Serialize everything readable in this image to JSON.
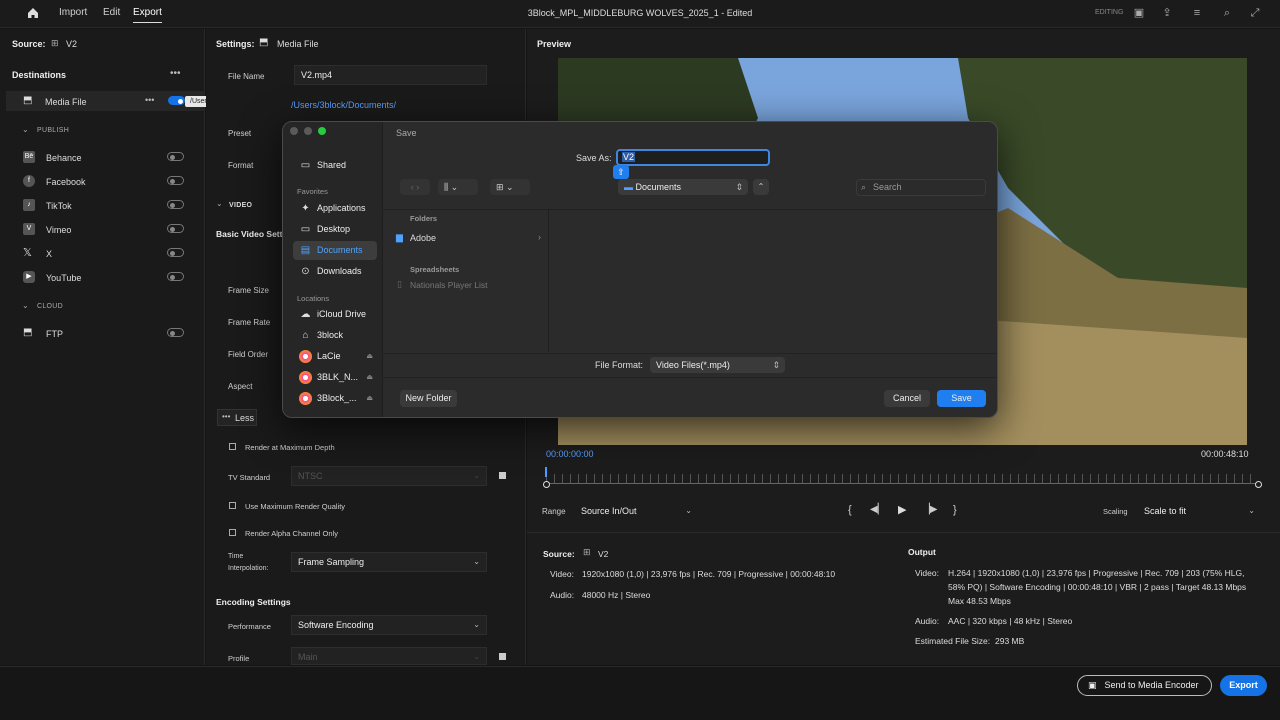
{
  "topbar": {
    "nav": [
      "Import",
      "Edit",
      "Export"
    ],
    "title": "3Block_MPL_MIDDLEBURG WOLVES_2025_1 - Edited",
    "mode": "EDITING"
  },
  "left": {
    "source_label": "Source:",
    "source_value": "V2",
    "destinations_title": "Destinations",
    "media_file": "Media File",
    "path_tooltip": "/Users/3block/Documents/",
    "publish_header": "PUBLISH",
    "publish_items": [
      "Behance",
      "Facebook",
      "TikTok",
      "Vimeo",
      "X",
      "YouTube"
    ],
    "cloud_header": "CLOUD",
    "cloud_items": [
      "FTP"
    ]
  },
  "settings": {
    "settings_label": "Settings:",
    "settings_value": "Media File",
    "file_name_label": "File Name",
    "file_name_value": "V2.mp4",
    "location_value": "/Users/3block/Documents/",
    "preset_label": "Preset",
    "format_label": "Format",
    "video_header": "VIDEO",
    "basic_video": "Basic Video Setti",
    "frame_size": "Frame Size",
    "frame_rate": "Frame Rate",
    "field_order": "Field Order",
    "aspect": "Aspect",
    "less_label": "Less",
    "render_max_depth": "Render at Maximum Depth",
    "tv_standard_label": "TV Standard",
    "tv_standard_value": "NTSC",
    "max_render_quality": "Use Maximum Render Quality",
    "alpha_only": "Render Alpha Channel Only",
    "time_interp_label_1": "Time",
    "time_interp_label_2": "Interpolation:",
    "time_interp_value": "Frame Sampling",
    "encoding_settings": "Encoding Settings",
    "performance_label": "Performance",
    "performance_value": "Software Encoding",
    "profile_label": "Profile",
    "profile_value": "Main"
  },
  "preview": {
    "title": "Preview",
    "time_start": "00:00:00:00",
    "time_end": "00:00:48:10",
    "range_label": "Range",
    "range_value": "Source In/Out",
    "scaling_label": "Scaling",
    "scaling_value": "Scale to fit"
  },
  "source_info": {
    "label": "Source:",
    "name": "V2",
    "video_label": "Video:",
    "video_value": "1920x1080 (1,0)  |  23,976 fps  |  Rec. 709  |  Progressive  |  00:00:48:10",
    "audio_label": "Audio:",
    "audio_value": "48000 Hz  |  Stereo"
  },
  "output_info": {
    "label": "Output",
    "video_label": "Video:",
    "video_line1": "H.264  |  1920x1080 (1,0)  |  23,976 fps  |  Progressive  |  Rec. 709  |  203 (75% HLG,",
    "video_line2": "58% PQ)  |  Software Encoding  |  00:00:48:10  |  VBR  |  2 pass  |  Target 48.13 Mbps",
    "video_line3": "Max 48.53 Mbps",
    "audio_label": "Audio:",
    "audio_value": "AAC  |  320 kbps  |  48 kHz  |  Stereo",
    "size_label": "Estimated File Size:",
    "size_value": "293 MB"
  },
  "footer": {
    "send_label": "Send to Media Encoder",
    "export_label": "Export"
  },
  "dialog": {
    "title": "Save",
    "save_as_label": "Save As:",
    "save_as_value": "V2",
    "location": "Documents",
    "search_placeholder": "Search",
    "sidebar_shared": "Shared",
    "favorites_header": "Favorites",
    "favorites": [
      "Applications",
      "Desktop",
      "Documents",
      "Downloads"
    ],
    "locations_header": "Locations",
    "locations": [
      "iCloud Drive",
      "3block",
      "LaCie",
      "3BLK_N...",
      "3Block_..."
    ],
    "folders_header": "Folders",
    "folder_adobe": "Adobe",
    "spreadsheets_header": "Spreadsheets",
    "spreadsheet_item": "Nationals Player List",
    "file_format_label": "File Format:",
    "file_format_value": "Video Files(*.mp4)",
    "new_folder": "New Folder",
    "cancel": "Cancel",
    "save": "Save"
  }
}
